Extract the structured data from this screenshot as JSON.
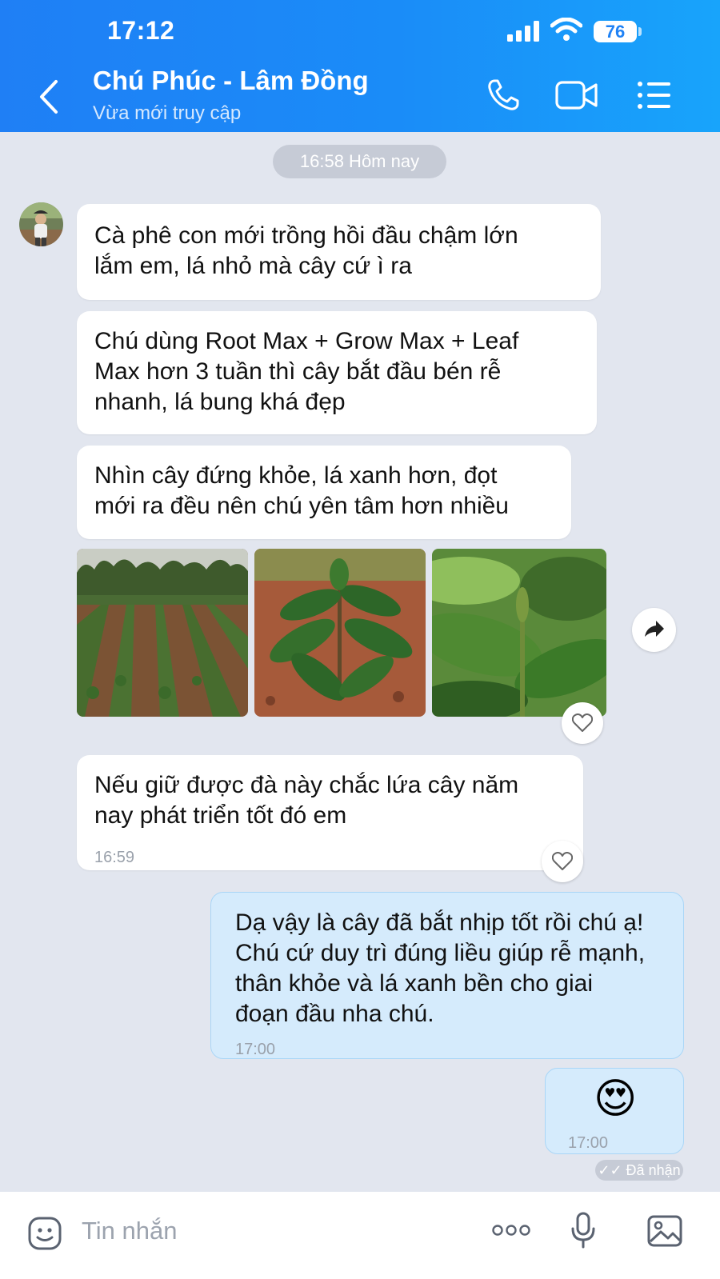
{
  "status_bar": {
    "time": "17:12",
    "battery": "76"
  },
  "header": {
    "contact_name": "Chú Phúc - Lâm Đồng",
    "contact_status": "Vừa mới truy cập"
  },
  "chat": {
    "date_chip": "16:58 Hôm nay",
    "messages": [
      {
        "text": "Cà phê con mới trồng hồi đầu chậm lớn\nlắm em, lá nhỏ mà cây cứ ì ra"
      },
      {
        "text": "Chú dùng Root Max + Grow Max + Leaf\nMax hơn 3 tuần thì cây bắt đầu bén rễ\nnhanh, lá bung khá đẹp"
      },
      {
        "text": "Nhìn cây đứng khỏe, lá xanh hơn, đọt\nmới ra đều nên chú yên tâm hơn nhiều"
      },
      {
        "text": "Nếu giữ được đà này chắc lứa cây năm\nnay phát triển tốt đó em",
        "time": "16:59"
      },
      {
        "text": "Dạ vậy là cây đã bắt nhịp tốt rồi chú ạ!\nChú cứ duy trì đúng liều giúp rễ mạnh,\nthân khỏe và lá xanh bền cho giai\nđoạn đầu nha chú.",
        "time": "17:00"
      },
      {
        "text": "😍",
        "time": "17:00"
      }
    ],
    "photos": [
      "coffee-field-photo",
      "coffee-seedling-photo",
      "coffee-leaf-closeup-photo"
    ],
    "delivered_status": "✓✓ Đã nhận"
  },
  "input_bar": {
    "placeholder": "Tin nhắn"
  },
  "colors": {
    "header_start": "#1f7ff5",
    "header_end": "#18a4fb",
    "chat_background": "#e2e6ef",
    "incoming_bubble": "#ffffff",
    "outgoing_bubble": "#d5ebfc"
  }
}
